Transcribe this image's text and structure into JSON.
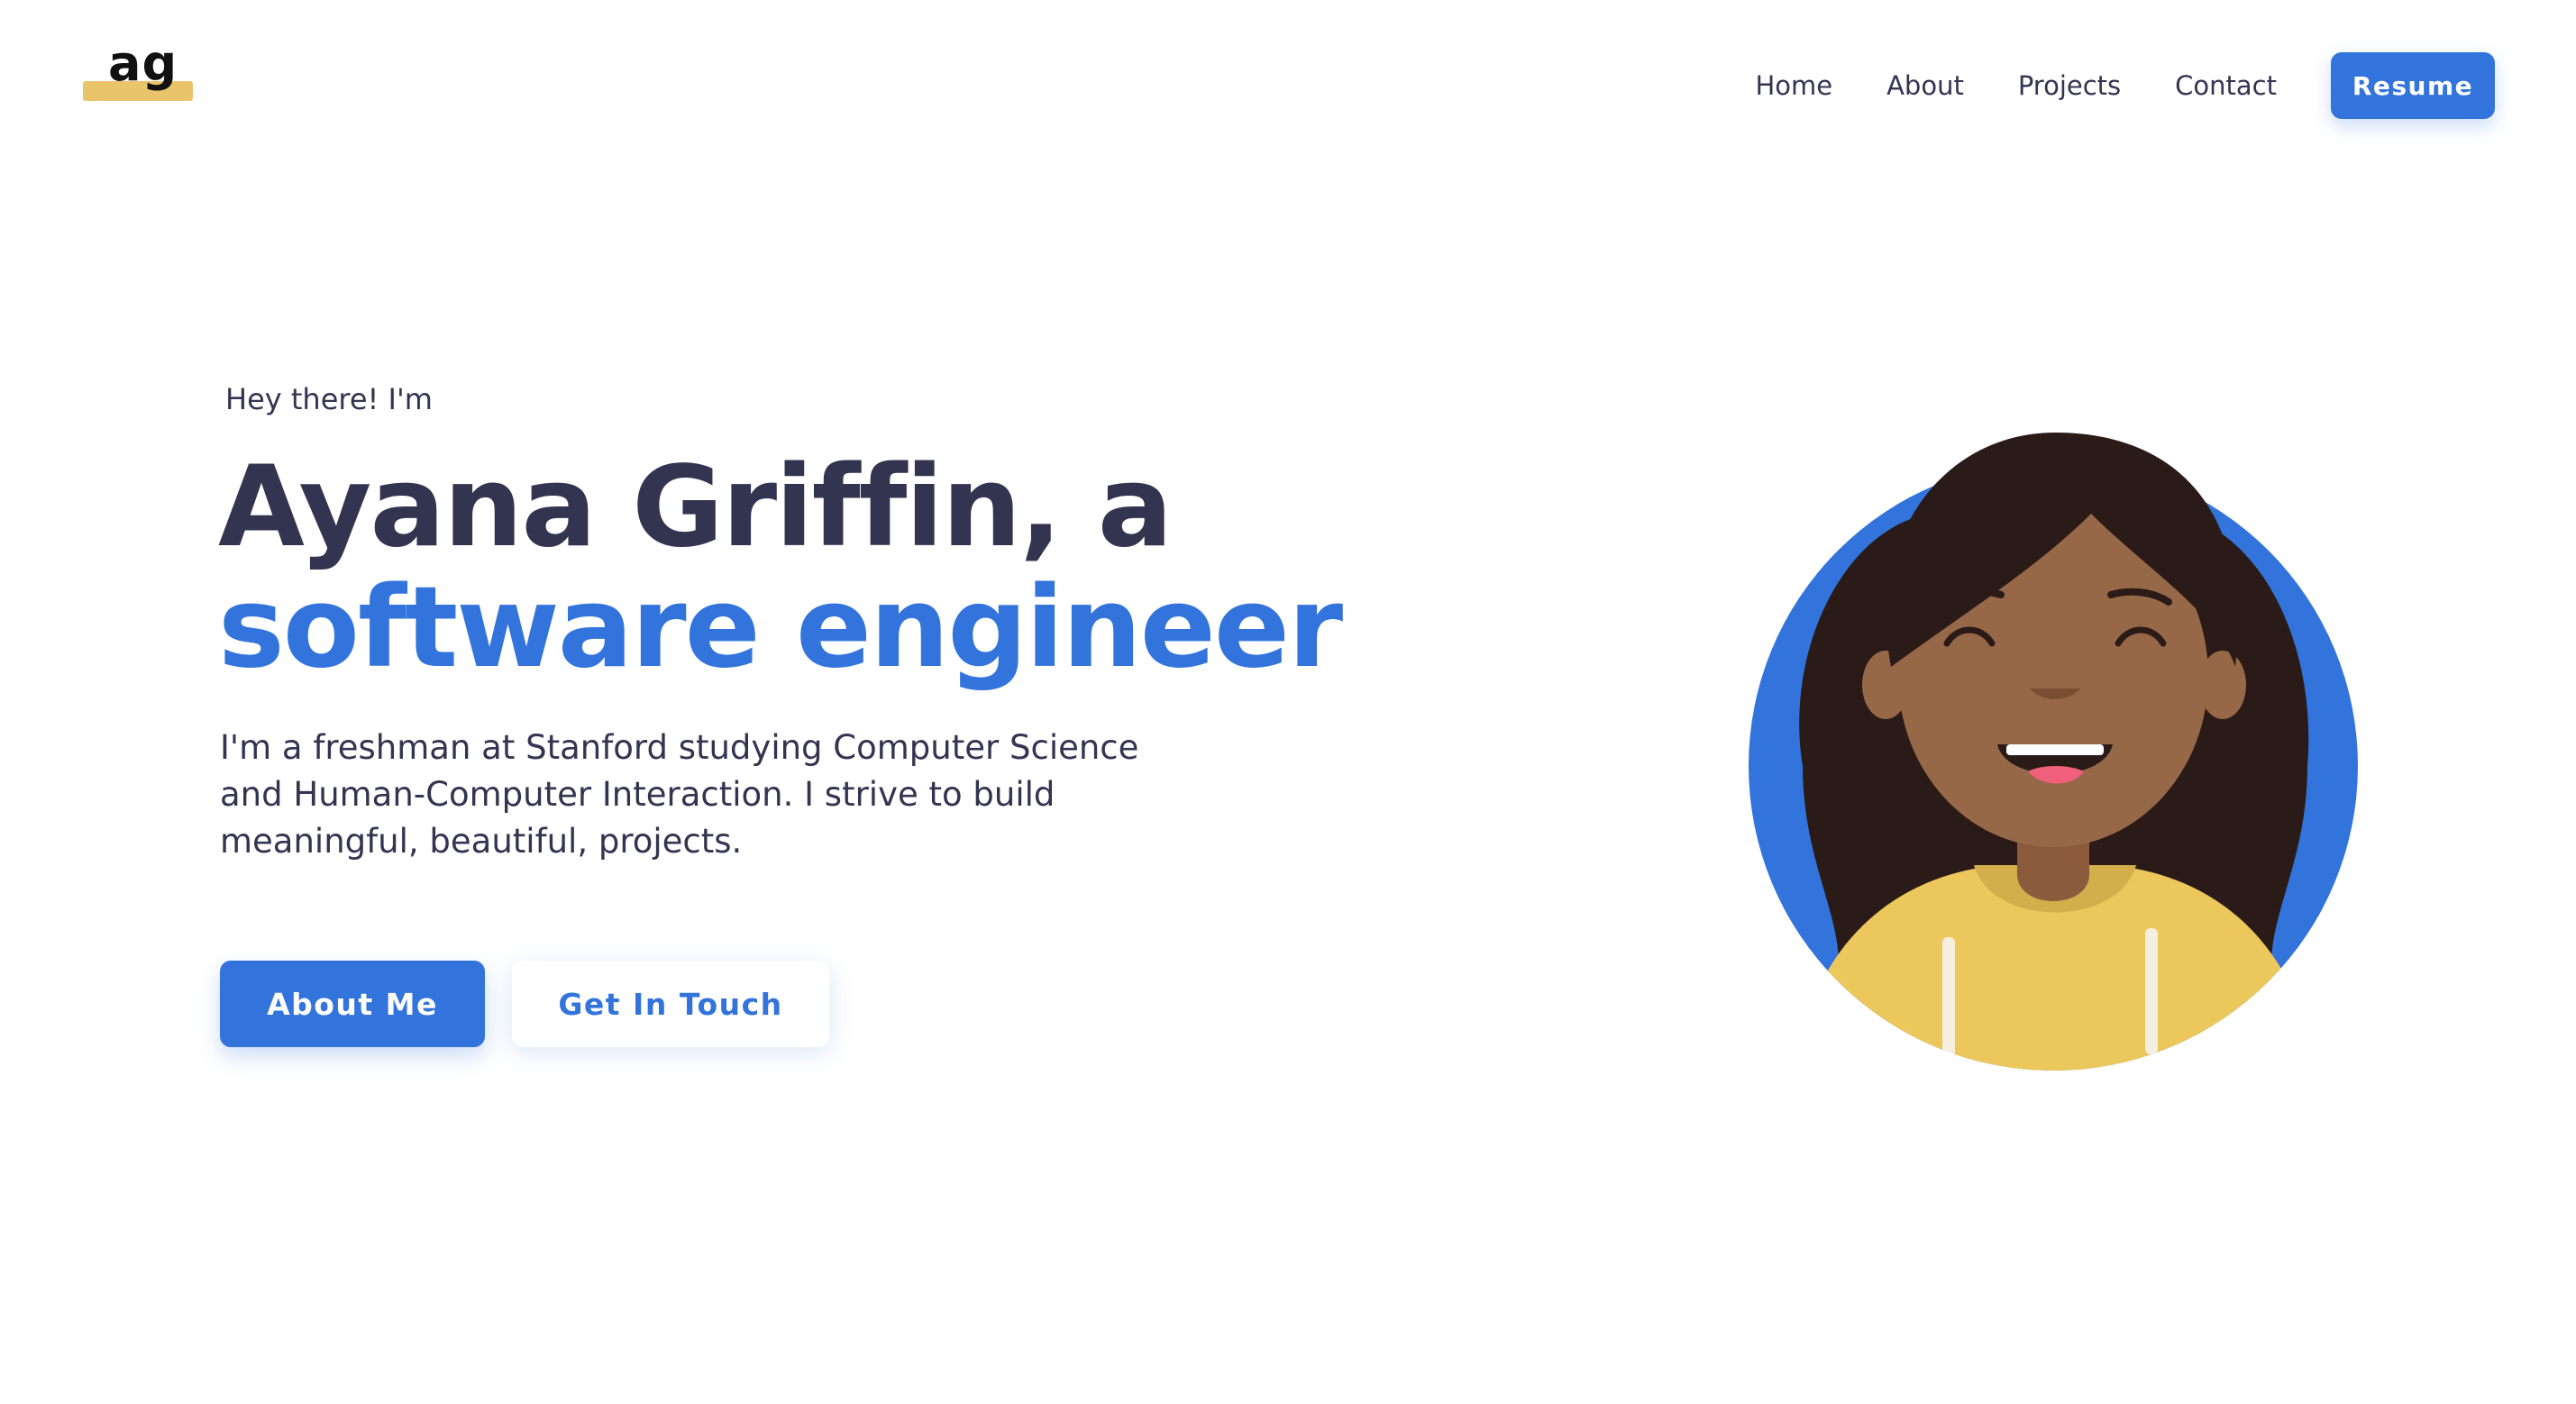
{
  "header": {
    "logo_text": "ag",
    "nav": {
      "home": "Home",
      "about": "About",
      "projects": "Projects",
      "contact": "Contact"
    },
    "resume_label": "Resume"
  },
  "hero": {
    "greeting": "Hey there! I'm",
    "title_line1": "Ayana Griffin, a",
    "title_line2": "software engineer",
    "description": "I'm a freshman at Stanford studying Computer Science and Human-Computer Interaction. I strive to build meaningful, beautiful, projects.",
    "about_button": "About Me",
    "contact_button": "Get In Touch"
  },
  "colors": {
    "accent": "#3274dc",
    "text": "#333450",
    "logo_highlight": "#e9c46a"
  },
  "icons": {
    "avatar": "avatar-illustration"
  }
}
